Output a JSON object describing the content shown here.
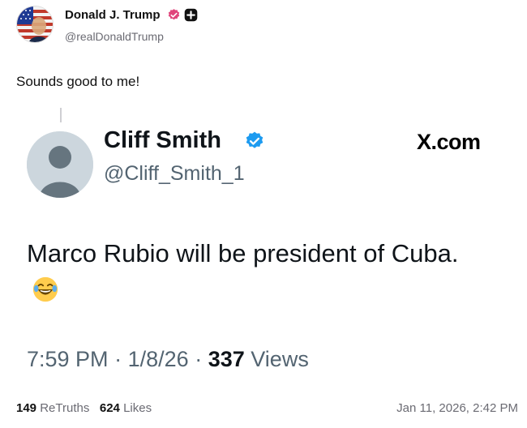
{
  "post": {
    "author_name": "Donald J. Trump",
    "author_handle": "@realDonaldTrump",
    "text": "Sounds good to me!"
  },
  "embed": {
    "name": "Cliff Smith",
    "handle": "@Cliff_Smith_1",
    "site": "X.com",
    "body": "Marco Rubio will be president of Cuba.",
    "emoji": "face-with-tears-of-joy",
    "time": "7:59 PM",
    "date": "1/8/26",
    "views_count": "337",
    "views_label": "Views",
    "separator": "·"
  },
  "footer": {
    "retruths_count": "149",
    "retruths_label": "ReTruths",
    "likes_count": "624",
    "likes_label": "Likes",
    "timestamp": "Jan 11, 2026, 2:42 PM"
  },
  "colors": {
    "verified_outer": "#e0457b",
    "verified_embed": "#1d9bf0",
    "muted_text": "#6b6b73"
  }
}
